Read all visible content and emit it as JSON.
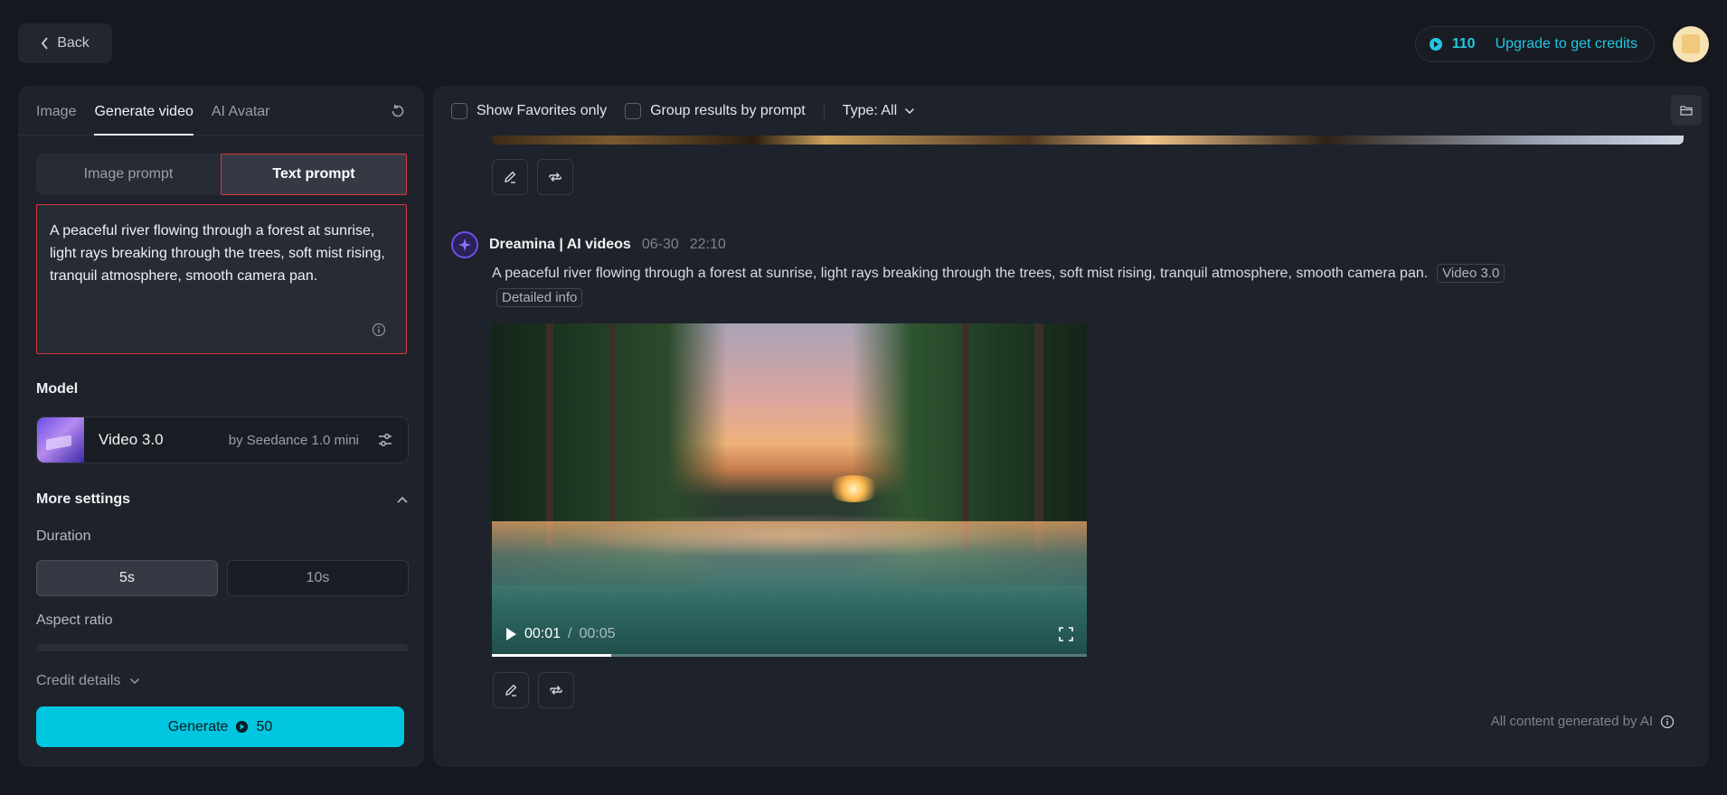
{
  "header": {
    "back_label": "Back",
    "credits": "110",
    "upgrade_label": "Upgrade to get credits"
  },
  "left": {
    "tabs": [
      {
        "label": "Image",
        "active": false
      },
      {
        "label": "Generate video",
        "active": true
      },
      {
        "label": "AI Avatar",
        "active": false
      }
    ],
    "prompt_modes": {
      "image": "Image prompt",
      "text": "Text prompt",
      "selected": "Text prompt"
    },
    "prompt_text": "A peaceful river flowing through a forest at sunrise, light rays breaking through the trees, soft mist rising, tranquil atmosphere, smooth camera pan.",
    "model_label": "Model",
    "model": {
      "name": "Video 3.0",
      "by": "by Seedance 1.0 mini"
    },
    "more_settings_label": "More settings",
    "duration_label": "Duration",
    "durations": [
      "5s",
      "10s"
    ],
    "duration_selected": "5s",
    "aspect_label": "Aspect ratio",
    "credit_details_label": "Credit details",
    "generate_label": "Generate",
    "generate_cost": "50"
  },
  "right": {
    "filters": {
      "favorites": "Show Favorites only",
      "group": "Group results by prompt",
      "type": "Type: All"
    },
    "item": {
      "brand": "Dreamina | AI videos",
      "date": "06-30",
      "time": "22:10",
      "prompt": "A peaceful river flowing through a forest at sunrise, light rays breaking through the trees, soft mist rising, tranquil atmosphere, smooth camera pan.",
      "model_tag": "Video 3.0",
      "detail_tag": "Detailed info",
      "video": {
        "current": "00:01",
        "total": "00:05",
        "progress": 0.2
      }
    },
    "footnote": "All content generated by AI"
  },
  "colors": {
    "accent": "#00c6df",
    "highlight_border": "#d63a3a",
    "brand_purple": "#6e4ee8"
  },
  "icons": [
    "chevron-left-icon",
    "credit-icon",
    "refresh-icon",
    "info-icon",
    "sliders-icon",
    "chevron-up-icon",
    "chevron-down-icon",
    "folder-icon",
    "edit-icon",
    "regenerate-icon",
    "play-icon",
    "fullscreen-icon",
    "brand-logo-icon"
  ]
}
